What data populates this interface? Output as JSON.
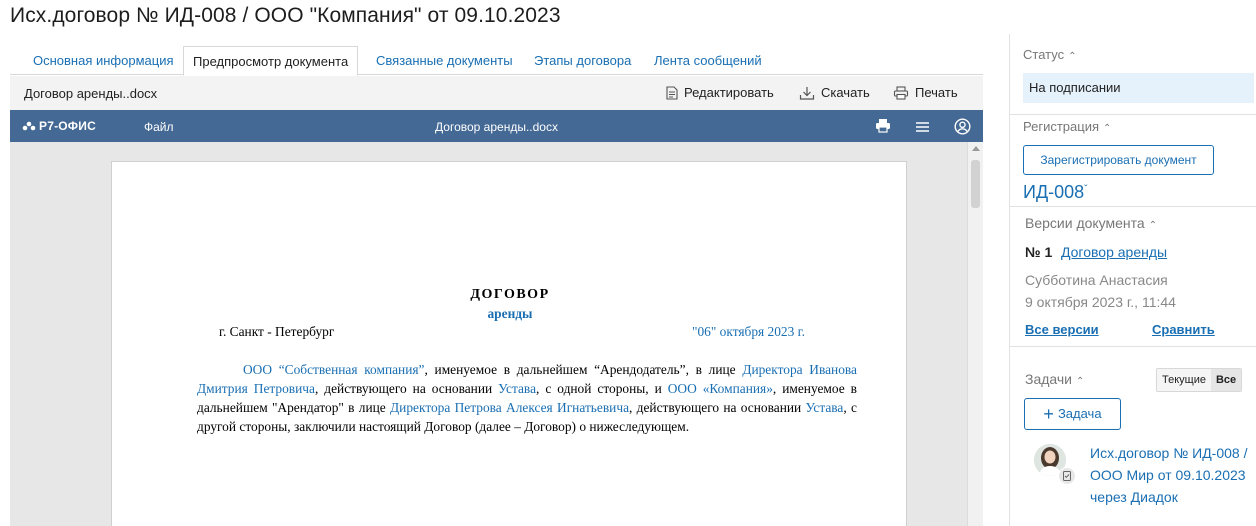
{
  "page": {
    "title": "Исх.договор № ИД-008 / ООО \"Компания\" от 09.10.2023"
  },
  "tabs": [
    {
      "label": "Основная информация",
      "active": false
    },
    {
      "label": "Предпросмотр документа",
      "active": true
    },
    {
      "label": "Связанные документы",
      "active": false
    },
    {
      "label": "Этапы договора",
      "active": false
    },
    {
      "label": "Лента сообщений",
      "active": false
    }
  ],
  "file_toolbar": {
    "file_name": "Договор аренды..docx",
    "edit_label": "Редактировать",
    "download_label": "Скачать",
    "print_label": "Печать"
  },
  "editor": {
    "brand": "Р7-ОФИС",
    "file_menu": "Файл",
    "doc_title": "Договор аренды..docx",
    "header_color": "#446995"
  },
  "document": {
    "heading": "ДОГОВОР",
    "subheading": "аренды",
    "city": "г. Санкт - Петербург",
    "date": "\"06\" октября  2023 г.",
    "paragraph": [
      {
        "text": "ООО “Собственная компания”",
        "field": true
      },
      {
        "text": ", именуемое в дальнейшем “Арендодатель”, в лице ",
        "field": false
      },
      {
        "text": "Директора Иванова Дмитрия Петровича",
        "field": true
      },
      {
        "text": ", действующего на основании ",
        "field": false
      },
      {
        "text": "Устава",
        "field": true
      },
      {
        "text": ", с одной стороны, и ",
        "field": false
      },
      {
        "text": "ООО «Компания»",
        "field": true
      },
      {
        "text": ", именуемое в дальнейшем \"Арендатор\" в лице ",
        "field": false
      },
      {
        "text": "Директора Петрова Алексея Игнатьевича",
        "field": true
      },
      {
        "text": ", действующего на основании ",
        "field": false
      },
      {
        "text": "Устава",
        "field": true
      },
      {
        "text": ", с другой стороны, заключили настоящий Договор (далее – Договор) о нижеследующем.",
        "field": false
      }
    ]
  },
  "status": {
    "title": "Статус",
    "value": "На подписании"
  },
  "registration": {
    "title": "Регистрация",
    "button_label": "Зарегистрировать документ",
    "number": "ИД-008"
  },
  "versions": {
    "title": "Версии документа",
    "number": "№ 1",
    "name": "Договор аренды",
    "author": "Субботина Анастасия",
    "date": "9 октября 2023 г., 11:44",
    "all_label": "Все версии",
    "compare_label": "Сравнить"
  },
  "tasks": {
    "title": "Задачи",
    "filter_current": "Текущие",
    "filter_all": "Все",
    "add_label": "Задача",
    "item_title": "Исх.договор № ИД-008 / ООО Мир от 09.10.2023 через Диадок"
  },
  "colors": {
    "accent": "#1a6fb3",
    "status_bg": "#e5f1fb"
  }
}
